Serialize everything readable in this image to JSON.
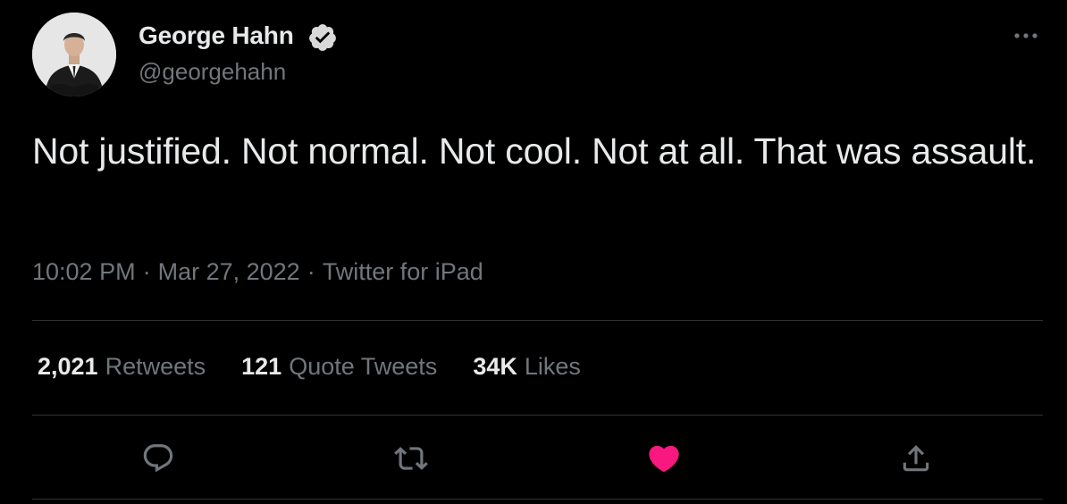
{
  "author": {
    "display_name": "George Hahn",
    "handle": "@georgehahn",
    "verified_icon": "verified-badge-icon",
    "avatar": "profile-photo"
  },
  "tweet": {
    "text": "Not justified. Not normal. Not cool. Not at all. That was assault.",
    "time": "10:02 PM",
    "date": "Mar 27, 2022",
    "source": "Twitter for iPad",
    "separator": "·"
  },
  "stats": {
    "retweets_count": "2,021",
    "retweets_label": "Retweets",
    "quotes_count": "121",
    "quotes_label": "Quote Tweets",
    "likes_count": "34K",
    "likes_label": "Likes"
  },
  "actions": [
    {
      "icon": "reply-icon"
    },
    {
      "icon": "retweet-icon"
    },
    {
      "icon": "like-icon",
      "active": true
    },
    {
      "icon": "share-icon"
    }
  ],
  "colors": {
    "background": "#000000",
    "primary_text": "#e7e9ea",
    "secondary_text": "#71767b",
    "divider": "#2f3336",
    "like_active": "#f91880"
  }
}
